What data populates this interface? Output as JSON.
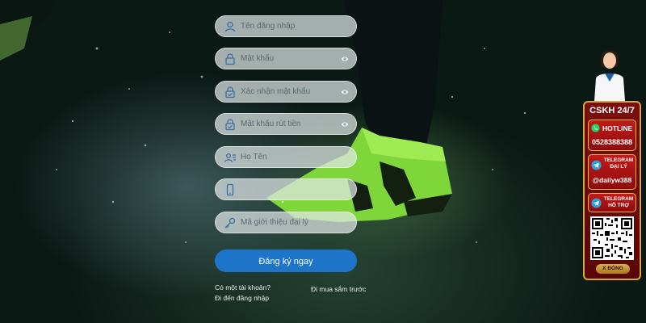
{
  "form": {
    "fields": [
      {
        "placeholder": "Tên đăng nhập",
        "icon": "user-icon",
        "has_eye": false
      },
      {
        "placeholder": "Mật khẩu",
        "icon": "lock-icon",
        "has_eye": true
      },
      {
        "placeholder": "Xác nhận mật khẩu",
        "icon": "lock-check-icon",
        "has_eye": true
      },
      {
        "placeholder": "Mật khẩu rút tiền",
        "icon": "lock-check-icon",
        "has_eye": true
      },
      {
        "placeholder": "Họ Tên",
        "icon": "id-card-icon",
        "has_eye": false
      },
      {
        "placeholder": "",
        "icon": "phone-icon",
        "has_eye": false
      },
      {
        "placeholder": "Mã giới thiệu đại lý",
        "icon": "key-icon",
        "has_eye": false
      }
    ],
    "submit_label": "Đăng ký ngay",
    "have_account_label": "Có một tài khoản?",
    "go_login_label": "Đi đến đăng nhập",
    "shop_label": "Đi mua sắm trước"
  },
  "support_panel": {
    "title": "CSKH 24/7",
    "hotline_label": "HOTLINE",
    "hotline_number": "0528388388",
    "telegram_agent_label_1": "TELEGRAM",
    "telegram_agent_label_2": "ĐẠI LÝ",
    "telegram_agent_handle": "@dailyw388",
    "telegram_support_label_1": "TELEGRAM",
    "telegram_support_label_2": "HỖ TRỢ",
    "close_label": "X ĐÓNG"
  },
  "colors": {
    "primary_button": "#1e74c8",
    "panel_red": "#7a0e0e",
    "panel_gold": "#d7a53c",
    "whatsapp_green": "#25d366",
    "telegram_blue": "#2aa3dc"
  }
}
